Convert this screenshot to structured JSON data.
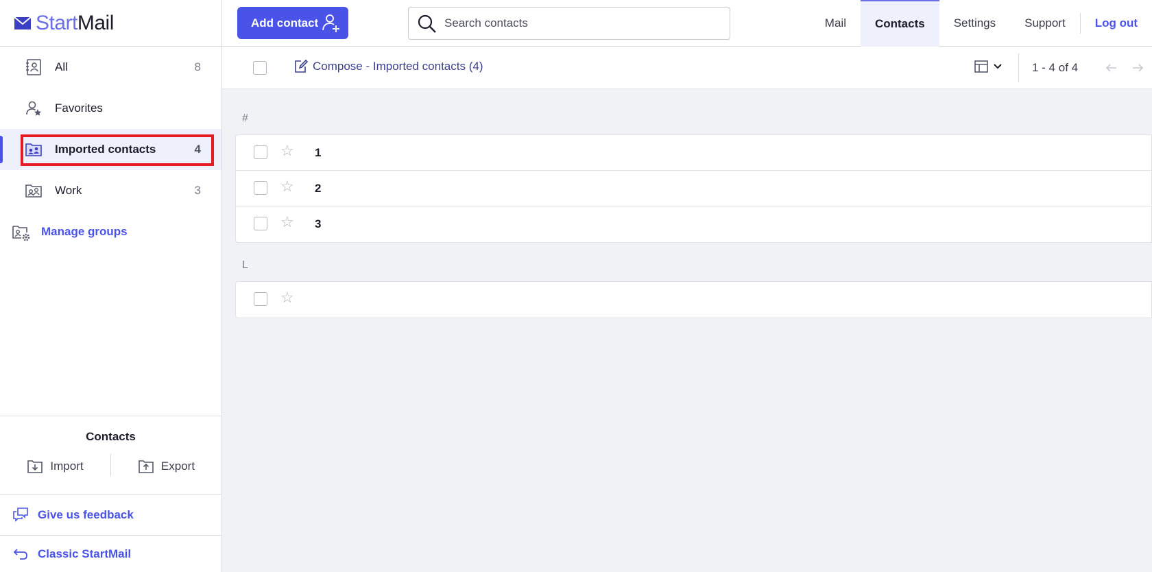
{
  "app": {
    "logo_start": "Start",
    "logo_mail": "Mail"
  },
  "sidebar": {
    "groups": [
      {
        "label": "All",
        "count": "8",
        "icon": "contact-book-icon"
      },
      {
        "label": "Favorites",
        "count": "",
        "icon": "favorite-contact-icon"
      },
      {
        "label": "Imported contacts",
        "count": "4",
        "icon": "folder-contacts-icon",
        "active": true
      },
      {
        "label": "Work",
        "count": "3",
        "icon": "folder-contacts-icon"
      }
    ],
    "manage_groups": "Manage groups",
    "contacts_title": "Contacts",
    "import_label": "Import",
    "export_label": "Export",
    "feedback_label": "Give us feedback",
    "classic_label": "Classic StartMail"
  },
  "topbar": {
    "add_contact": "Add contact",
    "search_placeholder": "Search contacts",
    "nav": [
      "Mail",
      "Contacts",
      "Settings",
      "Support"
    ],
    "logout": "Log out"
  },
  "toolbar": {
    "compose_label": "Compose - Imported contacts (4)",
    "paging": "1 - 4 of 4"
  },
  "sections": [
    {
      "letter": "#",
      "rows": [
        "1",
        "2",
        "3"
      ]
    },
    {
      "letter": "L",
      "rows": [
        ""
      ]
    }
  ],
  "colors": {
    "accent": "#4a53e8",
    "highlight": "#e51c23",
    "active_bg": "#eef0fc"
  }
}
